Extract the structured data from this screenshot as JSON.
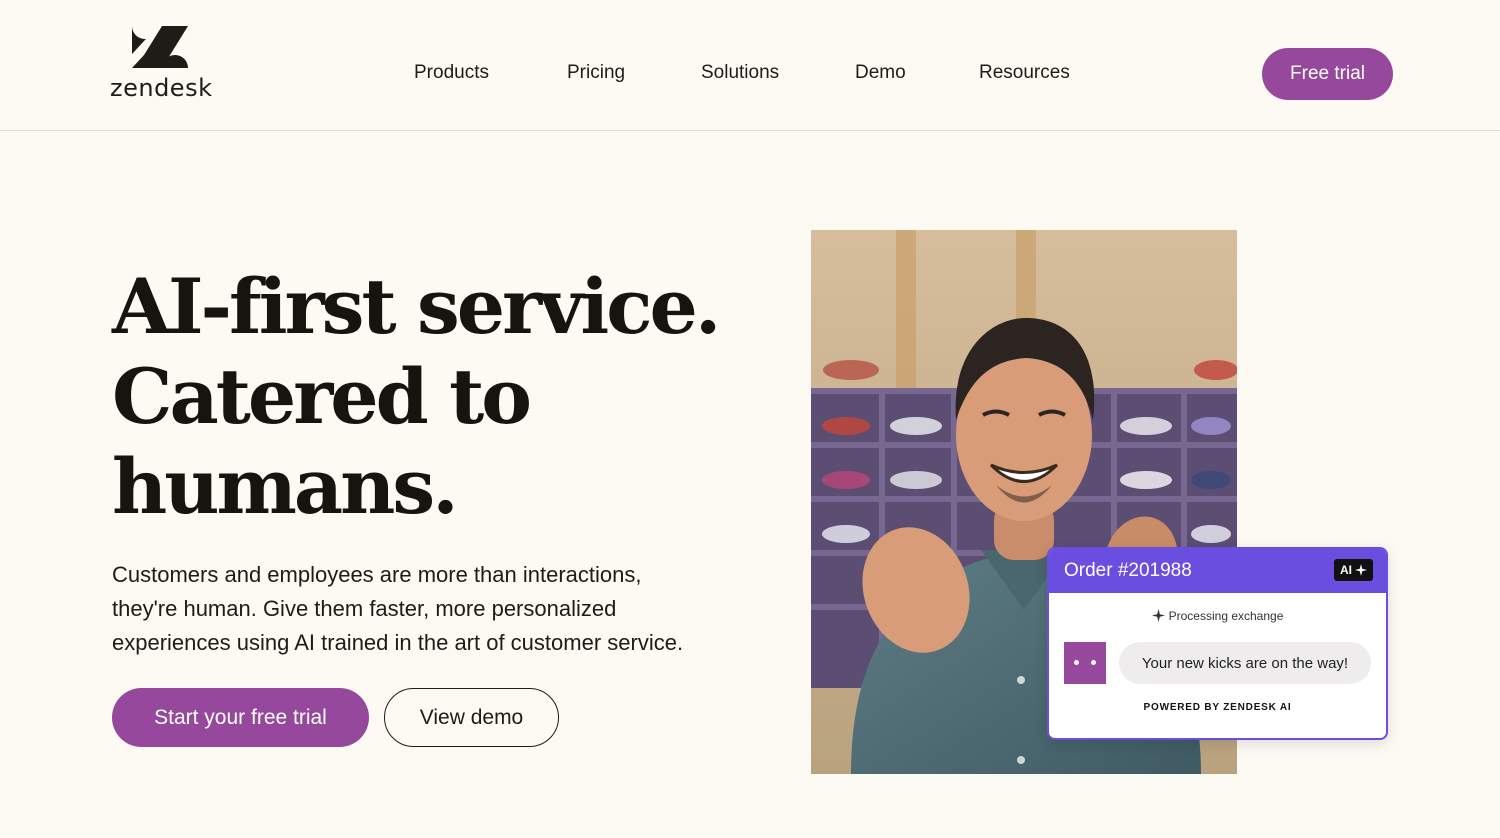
{
  "header": {
    "logo_text": "zendesk",
    "nav": [
      "Products",
      "Pricing",
      "Solutions",
      "Demo",
      "Resources"
    ],
    "cta": "Free trial"
  },
  "hero": {
    "headline": [
      "AI-first service.",
      "Catered to",
      "humans."
    ],
    "subcopy": [
      "Customers and employees are more than interactions,",
      "they're human. Give them faster, more personalized",
      "experiences using AI trained in the art of customer service."
    ],
    "primary_button": "Start your free trial",
    "secondary_button": "View demo"
  },
  "order_card": {
    "title": "Order #201988",
    "ai_badge": "AI",
    "status": "Processing exchange",
    "message": "Your new kicks are on the way!",
    "footer": "POWERED BY ZENDESK AI"
  },
  "colors": {
    "background": "#fdf9f3",
    "brand_purple": "#95489c",
    "card_violet": "#6a4ee0"
  },
  "icons": [
    "zendesk-logo-icon",
    "sparkle-icon",
    "bot-avatar-icon"
  ]
}
